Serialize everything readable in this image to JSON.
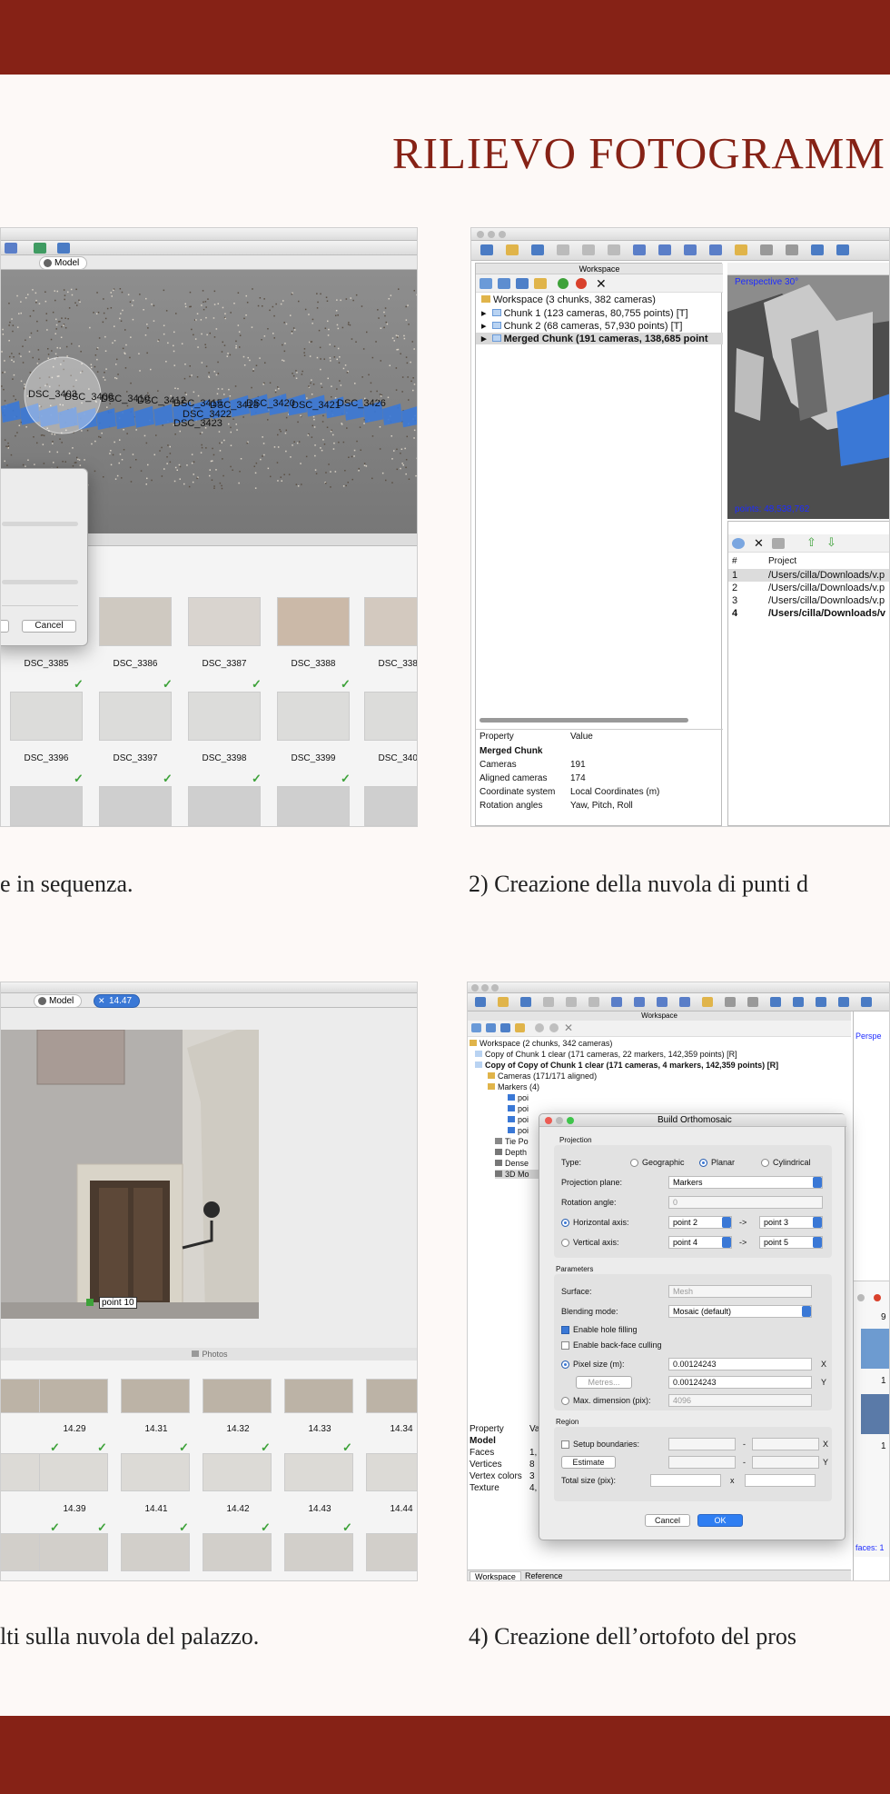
{
  "title": "RILIEVO FOTOGRAMM",
  "captions": {
    "c1": "e in sequenza.",
    "c2": "2) Creazione della nuvola di punti d",
    "c3": "lti sulla nuvola del palazzo.",
    "c4": "4) Creazione dell’ortofoto del pros"
  },
  "s1": {
    "model_tab": "Model",
    "cancel": "Cancel",
    "row1": [
      "DSC_3385",
      "DSC_3386",
      "DSC_3387",
      "DSC_3388",
      "DSC_3389"
    ],
    "row2": [
      "DSC_3396",
      "DSC_3397",
      "DSC_3398",
      "DSC_3399",
      "DSC_3400"
    ],
    "cloud_labels": [
      "DSC_3403",
      "DSC_3406",
      "DSC_3410",
      "DSC_3412",
      "DSC_3415",
      "DSC_3418",
      "DSC_3420",
      "DSC_3421",
      "DSC_3422",
      "DSC_3423",
      "DSC_3426"
    ]
  },
  "s2": {
    "workspace_title": "Workspace",
    "tree": [
      "Workspace (3 chunks, 382 cameras)",
      "Chunk 1 (123 cameras, 80,755 points) [T]",
      "Chunk 2 (68 cameras, 57,930 points) [T]",
      "Merged Chunk (191 cameras, 138,685 point"
    ],
    "perspective": "Perspective 30°",
    "points": "points: 48,538,762",
    "props_header": [
      "Property",
      "Value"
    ],
    "props_title": "Merged Chunk",
    "props": [
      [
        "Cameras",
        "191"
      ],
      [
        "Aligned cameras",
        "174"
      ],
      [
        "Coordinate system",
        "Local Coordinates (m)"
      ],
      [
        "Rotation angles",
        "Yaw, Pitch, Roll"
      ]
    ],
    "proj_header": [
      "#",
      "Project"
    ],
    "projects": [
      [
        "1",
        "/Users/cilla/Downloads/v.p"
      ],
      [
        "2",
        "/Users/cilla/Downloads/v.p"
      ],
      [
        "3",
        "/Users/cilla/Downloads/v.p"
      ],
      [
        "4",
        "/Users/cilla/Downloads/v"
      ]
    ]
  },
  "s3": {
    "model_tab": "Model",
    "photo_tab": "14.47",
    "marker": "point 10",
    "photos_label": "Photos",
    "row1": [
      "14.29",
      "14.31",
      "14.32",
      "14.33",
      "14.34"
    ],
    "row2": [
      "14.39",
      "14.41",
      "14.42",
      "14.43",
      "14.44"
    ]
  },
  "s4": {
    "workspace_title": "Workspace",
    "tree": [
      "Workspace (2 chunks, 342 cameras)",
      "Copy of Chunk 1 clear (171 cameras, 22 markers, 142,359 points) [R]",
      "Copy of Copy of Chunk 1 clear (171 cameras, 4 markers, 142,359 points) [R]",
      "Cameras (171/171 aligned)",
      "Markers (4)",
      "poi",
      "poi",
      "poi",
      "poi",
      "Tie Po",
      "Depth",
      "Dense",
      "3D Mo"
    ],
    "perspective": "Perspe",
    "props_header": [
      "Property",
      "Va"
    ],
    "props_title": "Model",
    "props": [
      [
        "Faces",
        "1,"
      ],
      [
        "Vertices",
        "8"
      ],
      [
        "Vertex colors",
        "3"
      ],
      [
        "Texture",
        "4,"
      ]
    ],
    "tabs": [
      "Workspace",
      "Reference"
    ],
    "side_labels": [
      "9",
      "1",
      "1"
    ],
    "faces_label": "faces: 1",
    "dialog": {
      "title": "Build Orthomosaic",
      "projection_label": "Projection",
      "type_label": "Type:",
      "types": [
        "Geographic",
        "Planar",
        "Cylindrical"
      ],
      "projection_plane_label": "Projection plane:",
      "projection_plane": "Markers",
      "rotation_label": "Rotation angle:",
      "rotation": "0",
      "horizontal_label": "Horizontal axis:",
      "h_from": "point 2",
      "h_to": "point 3",
      "vertical_label": "Vertical axis:",
      "v_from": "point 4",
      "v_to": "point 5",
      "arrow": "->",
      "parameters_label": "Parameters",
      "surface_label": "Surface:",
      "surface": "Mesh",
      "blending_label": "Blending mode:",
      "blending": "Mosaic (default)",
      "hole_filling": "Enable hole filling",
      "backface": "Enable back-face culling",
      "pixel_size_label": "Pixel size (m):",
      "pixel_x": "0.00124243",
      "pixel_y": "0.00124243",
      "x": "X",
      "y": "Y",
      "metres": "Metres...",
      "max_dim_label": "Max. dimension (pix):",
      "max_dim": "4096",
      "region_label": "Region",
      "setup_boundaries": "Setup boundaries:",
      "estimate": "Estimate",
      "dash": "-",
      "total_size_label": "Total size (pix):",
      "times": "x",
      "cancel": "Cancel",
      "ok": "OK"
    }
  }
}
